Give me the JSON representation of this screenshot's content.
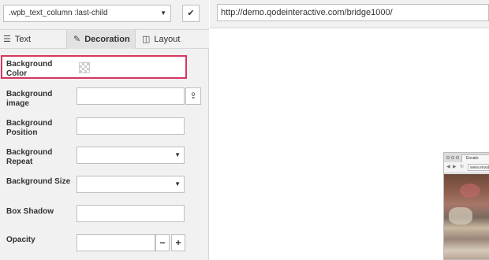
{
  "selector": {
    "value": ".wpb_text_column :last-child",
    "apply_icon": "checkmark-icon"
  },
  "tabs": [
    {
      "label": "Text",
      "icon": "lines-icon"
    },
    {
      "label": "Decoration",
      "icon": "eyedropper-icon"
    },
    {
      "label": "Layout",
      "icon": "columns-icon"
    }
  ],
  "fields": {
    "bg_color": {
      "label": "Background Color"
    },
    "bg_image": {
      "label": "Background image",
      "upload_icon": "upload-icon"
    },
    "bg_position": {
      "label": "Background Position"
    },
    "bg_repeat": {
      "label": "Background Repeat"
    },
    "bg_size": {
      "label": "Background Size"
    },
    "box_shadow": {
      "label": "Box Shadow"
    },
    "opacity": {
      "label": "Opacity",
      "minus": "−",
      "plus": "+"
    }
  },
  "address": {
    "url": "http://demo.qodeinteractive.com/bridge1000/"
  },
  "mini_browser": {
    "tab_label": "Envato",
    "url": "www.envato"
  },
  "colors": {
    "highlight": "#d9365e",
    "panel_bg": "#f1f1f1"
  }
}
